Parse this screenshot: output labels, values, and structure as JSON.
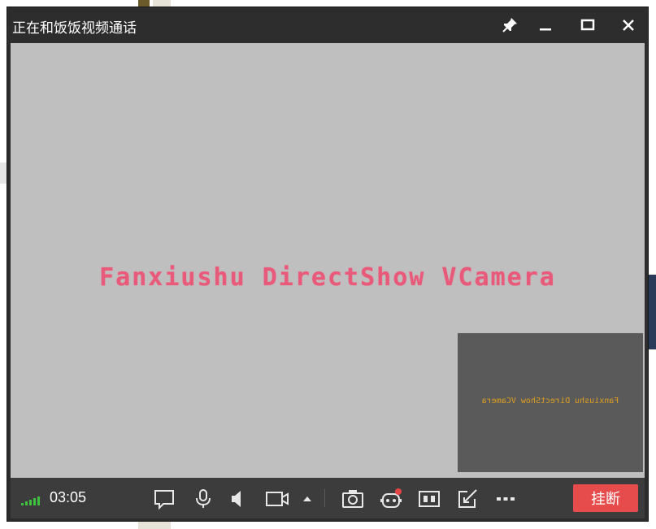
{
  "window": {
    "title": "正在和饭饭视频通话"
  },
  "titlebar_buttons": [
    {
      "name": "pin",
      "icon": "pin-icon"
    },
    {
      "name": "minimize",
      "icon": "minimize-icon"
    },
    {
      "name": "maximize",
      "icon": "maximize-icon"
    },
    {
      "name": "close",
      "icon": "close-icon"
    }
  ],
  "video": {
    "remote_text": "Fanxiushu DirectShow VCamera",
    "self_preview_text": "Fanxiushu DirectShow VCamera"
  },
  "call": {
    "duration": "03:05",
    "signal_bars": 5,
    "hangup_label": "挂断"
  },
  "controls": [
    {
      "name": "chat",
      "icon": "chat-bubble-icon"
    },
    {
      "name": "microphone",
      "icon": "microphone-icon"
    },
    {
      "name": "speaker",
      "icon": "speaker-icon"
    },
    {
      "name": "camera",
      "icon": "video-camera-icon"
    },
    {
      "name": "camera-options",
      "icon": "caret-up-icon"
    },
    {
      "name": "screenshot",
      "icon": "camera-icon"
    },
    {
      "name": "effects",
      "icon": "robot-face-icon",
      "has_badge": true
    },
    {
      "name": "layout",
      "icon": "split-layout-icon"
    },
    {
      "name": "share",
      "icon": "edit-share-icon"
    },
    {
      "name": "more",
      "icon": "more-icon"
    }
  ],
  "colors": {
    "titlebar": "#2d2d2d",
    "video_bg": "#bfbfbf",
    "pip_bg": "#5a5a5a",
    "control_bar": "#3c3c3c",
    "signal": "#3ec13e",
    "hangup": "#e74c4c",
    "overlay_text": "#e85a7a",
    "pip_text": "#e0a020"
  }
}
